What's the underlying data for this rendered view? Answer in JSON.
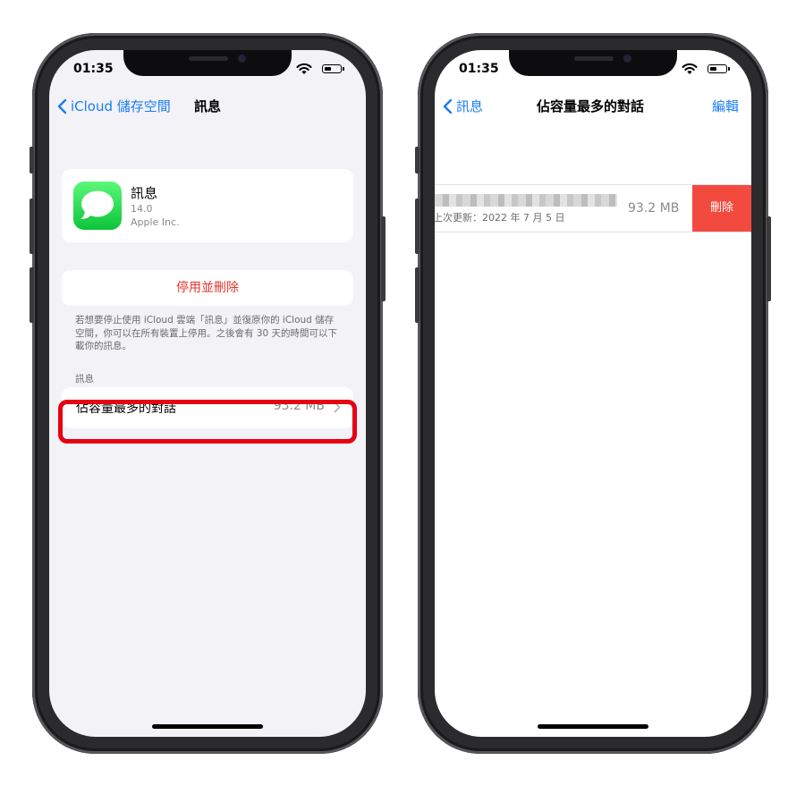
{
  "colors": {
    "accent": "#1a7cf5",
    "destructive": "#e5352d",
    "delete_bg": "#f34a3f",
    "highlight": "#e60012"
  },
  "left": {
    "status": {
      "time": "01:35"
    },
    "nav": {
      "back_label": "iCloud 儲存空間",
      "title": "訊息"
    },
    "app": {
      "icon": "messages-app-icon",
      "name": "訊息",
      "version": "14.0",
      "developer": "Apple Inc."
    },
    "disable_button": "停用並刪除",
    "footnote": "若想要停止使用 iCloud 雲端「訊息」並復原你的 iCloud 儲存空間，你可以在所有裝置上停用。之後會有 30 天的時間可以下載你的訊息。",
    "section_header": "訊息",
    "top_conversations": {
      "label": "佔容量最多的對話",
      "value": "93.2 MB"
    }
  },
  "right": {
    "status": {
      "time": "01:35"
    },
    "nav": {
      "back_label": "訊息",
      "title": "佔容量最多的對話",
      "action": "編輯"
    },
    "conversation": {
      "date": "上次更新：2022 年 7 月 5 日",
      "size": "93.2 MB",
      "delete_label": "刪除"
    }
  }
}
